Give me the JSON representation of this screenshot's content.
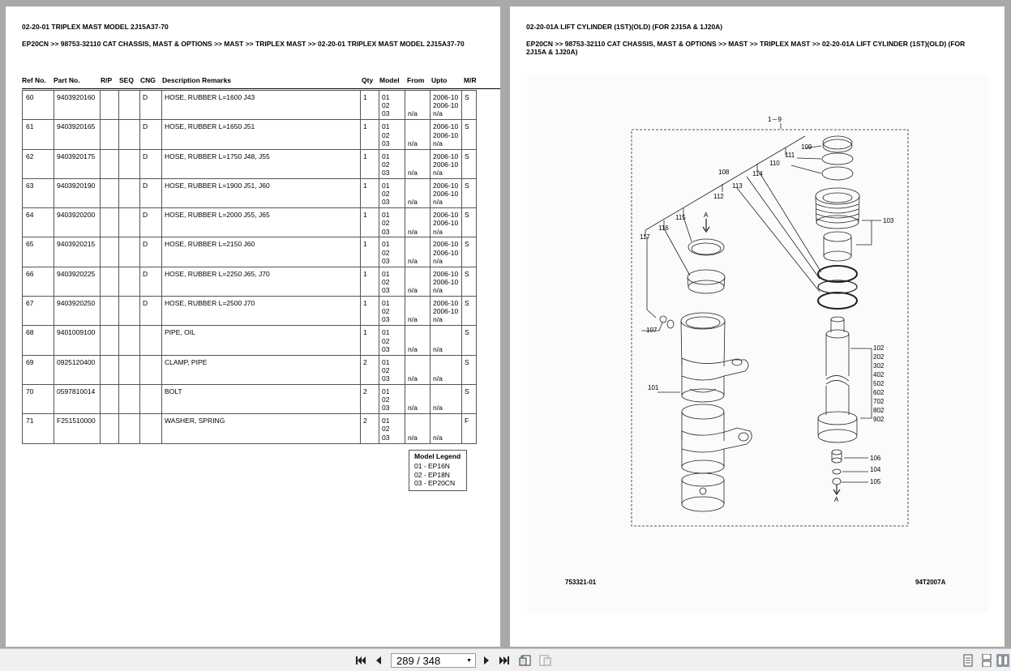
{
  "left_page": {
    "title": "02-20-01 TRIPLEX MAST MODEL 2J15A37-70",
    "breadcrumb": "EP20CN >> 98753-32110 CAT CHASSIS, MAST & OPTIONS >> MAST >> TRIPLEX MAST >> 02-20-01 TRIPLEX MAST MODEL 2J15A37-70",
    "columns": [
      "Ref No.",
      "Part No.",
      "R/P",
      "SEQ",
      "CNG",
      "Description Remarks",
      "Qty",
      "Model",
      "From",
      "Upto",
      "M/R"
    ],
    "rows": [
      {
        "ref": "60",
        "part": "9403920160",
        "cng": "D",
        "desc": "HOSE, RUBBER L=1600 J43",
        "qty": "1",
        "model": "01\n02\n03",
        "from": "\n\nn/a",
        "upto": "2006-10\n2006-10\nn/a",
        "mr": "S"
      },
      {
        "ref": "61",
        "part": "9403920165",
        "cng": "D",
        "desc": "HOSE, RUBBER L=1650 J51",
        "qty": "1",
        "model": "01\n02\n03",
        "from": "\n\nn/a",
        "upto": "2006-10\n2006-10\nn/a",
        "mr": "S"
      },
      {
        "ref": "62",
        "part": "9403920175",
        "cng": "D",
        "desc": "HOSE, RUBBER L=1750 J48, J55",
        "qty": "1",
        "model": "01\n02\n03",
        "from": "\n\nn/a",
        "upto": "2006-10\n2006-10\nn/a",
        "mr": "S"
      },
      {
        "ref": "63",
        "part": "9403920190",
        "cng": "D",
        "desc": "HOSE, RUBBER L=1900 J51, J60",
        "qty": "1",
        "model": "01\n02\n03",
        "from": "\n\nn/a",
        "upto": "2006-10\n2006-10\nn/a",
        "mr": "S"
      },
      {
        "ref": "64",
        "part": "9403920200",
        "cng": "D",
        "desc": "HOSE, RUBBER L=2000 J55, J65",
        "qty": "1",
        "model": "01\n02\n03",
        "from": "\n\nn/a",
        "upto": "2006-10\n2006-10\nn/a",
        "mr": "S"
      },
      {
        "ref": "65",
        "part": "9403920215",
        "cng": "D",
        "desc": "HOSE, RUBBER L=2150 J60",
        "qty": "1",
        "model": "01\n02\n03",
        "from": "\n\nn/a",
        "upto": "2006-10\n2006-10\nn/a",
        "mr": "S"
      },
      {
        "ref": "66",
        "part": "9403920225",
        "cng": "D",
        "desc": "HOSE, RUBBER L=2250 J65, J70",
        "qty": "1",
        "model": "01\n02\n03",
        "from": "\n\nn/a",
        "upto": "2006-10\n2006-10\nn/a",
        "mr": "S"
      },
      {
        "ref": "67",
        "part": "9403920250",
        "cng": "D",
        "desc": "HOSE, RUBBER L=2500 J70",
        "qty": "1",
        "model": "01\n02\n03",
        "from": "\n\nn/a",
        "upto": "2006-10\n2006-10\nn/a",
        "mr": "S"
      },
      {
        "ref": "68",
        "part": "9401009100",
        "cng": "",
        "desc": "PIPE, OIL",
        "qty": "1",
        "model": "01\n02\n03",
        "from": "\n\nn/a",
        "upto": "\n\nn/a",
        "mr": "S"
      },
      {
        "ref": "69",
        "part": "0925120400",
        "cng": "",
        "desc": "CLAMP, PIPE",
        "qty": "2",
        "model": "01\n02\n03",
        "from": "\n\nn/a",
        "upto": "\n\nn/a",
        "mr": "S"
      },
      {
        "ref": "70",
        "part": "0597810014",
        "cng": "",
        "desc": "BOLT",
        "qty": "2",
        "model": "01\n02\n03",
        "from": "\n\nn/a",
        "upto": "\n\nn/a",
        "mr": "S"
      },
      {
        "ref": "71",
        "part": "F251510000",
        "cng": "",
        "desc": "WASHER, SPRING",
        "qty": "2",
        "model": "01\n02\n03",
        "from": "\n\nn/a",
        "upto": "\n\nn/a",
        "mr": "F"
      }
    ],
    "legend": {
      "title": "Model Legend",
      "items": [
        "01 - EP16N",
        "02 - EP18N",
        "03 - EP20CN"
      ]
    }
  },
  "right_page": {
    "title": "02-20-01A LIFT CYLINDER (1ST)(OLD) (FOR 2J15A & 1J20A)",
    "breadcrumb": "EP20CN >> 98753-32110 CAT CHASSIS, MAST & OPTIONS >> MAST >> TRIPLEX MAST >> 02-20-01A LIFT CYLINDER (1ST)(OLD) (FOR 2J15A & 1J20A)",
    "drawing_labels": {
      "l19": "1－9",
      "l109": "109",
      "l111": "111",
      "l110": "110",
      "l108": "108",
      "l114": "114",
      "l113": "113",
      "l112": "112",
      "l103": "103",
      "l115": "115",
      "lA1": "A",
      "l116": "116",
      "l117": "117",
      "l107": "107",
      "l101": "101",
      "l102": "102",
      "l202": "202",
      "l302": "302",
      "l402": "402",
      "l502": "502",
      "l602": "602",
      "l702": "702",
      "l802": "802",
      "l902": "902",
      "l106": "106",
      "l104": "104",
      "l105": "105",
      "lA2": "A"
    },
    "drawing_no_left": "753321-01",
    "drawing_no_right": "94T2007A"
  },
  "toolbar": {
    "page_indicator": "289 / 348"
  }
}
